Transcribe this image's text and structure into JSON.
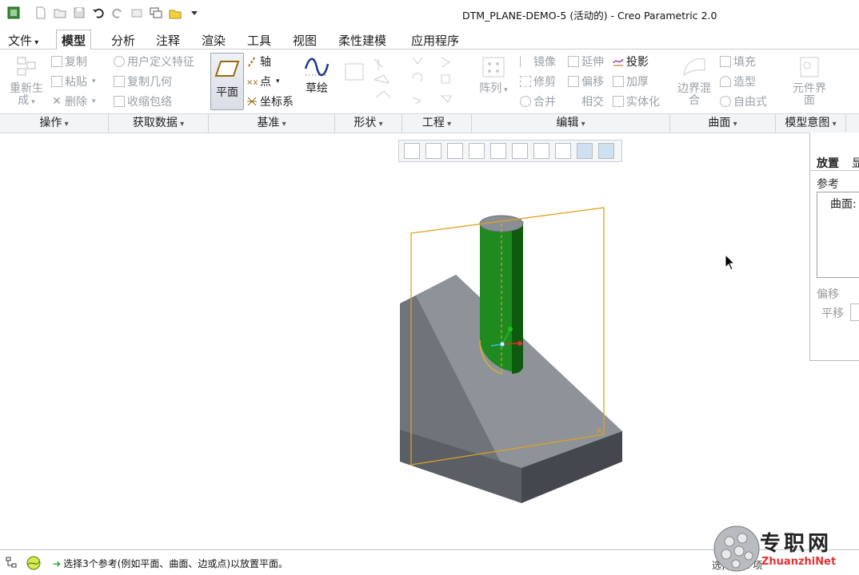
{
  "window": {
    "title": "DTM_PLANE-DEMO-5 (活动的) - Creo Parametric 2.0"
  },
  "quick_access": {
    "icons": [
      "app-icon",
      "new-icon",
      "open-icon",
      "save-icon",
      "undo-icon",
      "redo-icon",
      "regenerate-icon",
      "windows-icon",
      "close-window-icon",
      "customize-icon"
    ]
  },
  "tabs": [
    {
      "label": "文件",
      "active": false
    },
    {
      "label": "模型",
      "active": true
    },
    {
      "label": "分析",
      "active": false
    },
    {
      "label": "注释",
      "active": false
    },
    {
      "label": "渲染",
      "active": false
    },
    {
      "label": "工具",
      "active": false
    },
    {
      "label": "视图",
      "active": false
    },
    {
      "label": "柔性建模",
      "active": false
    },
    {
      "label": "应用程序",
      "active": false
    }
  ],
  "ribbon": {
    "operations": {
      "regenerate_line1": "重新生",
      "regenerate_line2": "成",
      "copy": "复制",
      "paste": "粘贴",
      "delete": "删除"
    },
    "get_data": {
      "udf": "用户定义特征",
      "copy_geom": "复制几何",
      "shrinkwrap": "收缩包络"
    },
    "datum": {
      "plane": "平面",
      "axis": "轴",
      "point": "点",
      "csys": "坐标系",
      "sketch": "草绘"
    },
    "engineering": {},
    "editing": {
      "pattern": "阵列",
      "mirror": "镜像",
      "trim": "修剪",
      "merge": "合并",
      "extend": "延伸",
      "offset": "偏移",
      "intersect": "相交",
      "project": "投影",
      "thicken": "加厚",
      "solidify": "实体化"
    },
    "surfaces": {
      "boundary_line1": "边界混",
      "boundary_line2": "合",
      "fill": "填充",
      "style": "造型",
      "freestyle": "自由式"
    },
    "model_intent": {
      "component_line1": "元件界",
      "component_line2": "面"
    }
  },
  "groups": [
    {
      "label": "操作"
    },
    {
      "label": "获取数据"
    },
    {
      "label": "基准"
    },
    {
      "label": "形状"
    },
    {
      "label": "工程"
    },
    {
      "label": "编辑"
    },
    {
      "label": "曲面"
    },
    {
      "label": "模型意图"
    }
  ],
  "dashboard_panel": {
    "tab_placement": "放置",
    "tab_display": "显",
    "references_label": "参考",
    "reference_item": "曲面:",
    "offset_label": "偏移",
    "translate_label": "平移"
  },
  "colors": {
    "cylinder": "#1f8a1f",
    "block": "#8a8f96",
    "datum_plane": "#e0a020"
  },
  "status": {
    "message": "选择3个参考(例如平面、曲面、边或点)以放置平面。",
    "right_text": "选择了 1 项"
  },
  "watermark": {
    "text": "专职网",
    "url": "ZhuanzhiNet"
  }
}
